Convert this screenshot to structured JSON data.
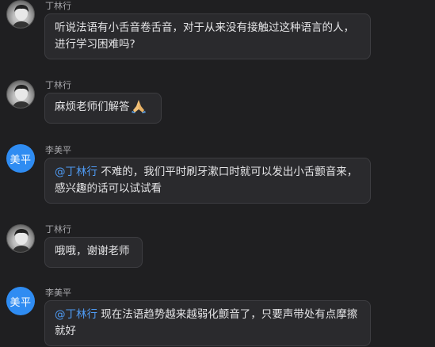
{
  "messages": [
    {
      "sender": "丁林行",
      "avatar_type": "photo",
      "text": "听说法语有小舌音卷舌音，对于从来没有接触过这种语言的人，进行学习困难吗?"
    },
    {
      "sender": "丁林行",
      "avatar_type": "photo",
      "text": "麻烦老师们解答",
      "emoji": "folded-hands-icon"
    },
    {
      "sender": "李美平",
      "avatar_type": "text",
      "avatar_text": "美平",
      "mention": "@丁林行",
      "text": " 不难的，我们平时刷牙漱口时就可以发出小舌颤音来，感兴趣的话可以试试看"
    },
    {
      "sender": "丁林行",
      "avatar_type": "photo",
      "text": "哦哦，谢谢老师"
    },
    {
      "sender": "李美平",
      "avatar_type": "text",
      "avatar_text": "美平",
      "mention": "@丁林行",
      "text": " 现在法语趋势越来越弱化颤音了，只要声带处有点摩擦就好"
    }
  ],
  "colors": {
    "background": "#1f1f21",
    "bubble": "#2a2a2d",
    "bubble_border": "#3d3d41",
    "mention": "#4f9cf5",
    "avatar_blue": "#2f8cf2"
  }
}
